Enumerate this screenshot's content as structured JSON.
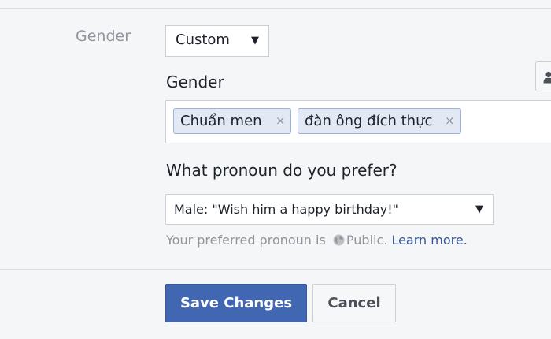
{
  "gender_row": {
    "label": "Gender",
    "selected": "Custom"
  },
  "custom_gender": {
    "heading": "Gender",
    "tokens": [
      {
        "label": "Chuẩn men",
        "remove": "×"
      },
      {
        "label": "đàn ông đích thực",
        "remove": "×"
      }
    ]
  },
  "pronoun": {
    "heading": "What pronoun do you prefer?",
    "selected": "Male: \"Wish him a happy birthday!\"",
    "help_prefix": "Your preferred pronoun is",
    "help_audience": "Public.",
    "help_link": "Learn more."
  },
  "actions": {
    "save_label": "Save Changes",
    "cancel_label": "Cancel"
  },
  "icons": {
    "caret": "dropdown-caret-icon",
    "remove": "remove-x-icon",
    "globe": "globe-icon",
    "people": "person-icon"
  },
  "colors": {
    "primary": "#4267b2",
    "link": "#365899",
    "token_bg": "#e2e8f4"
  }
}
